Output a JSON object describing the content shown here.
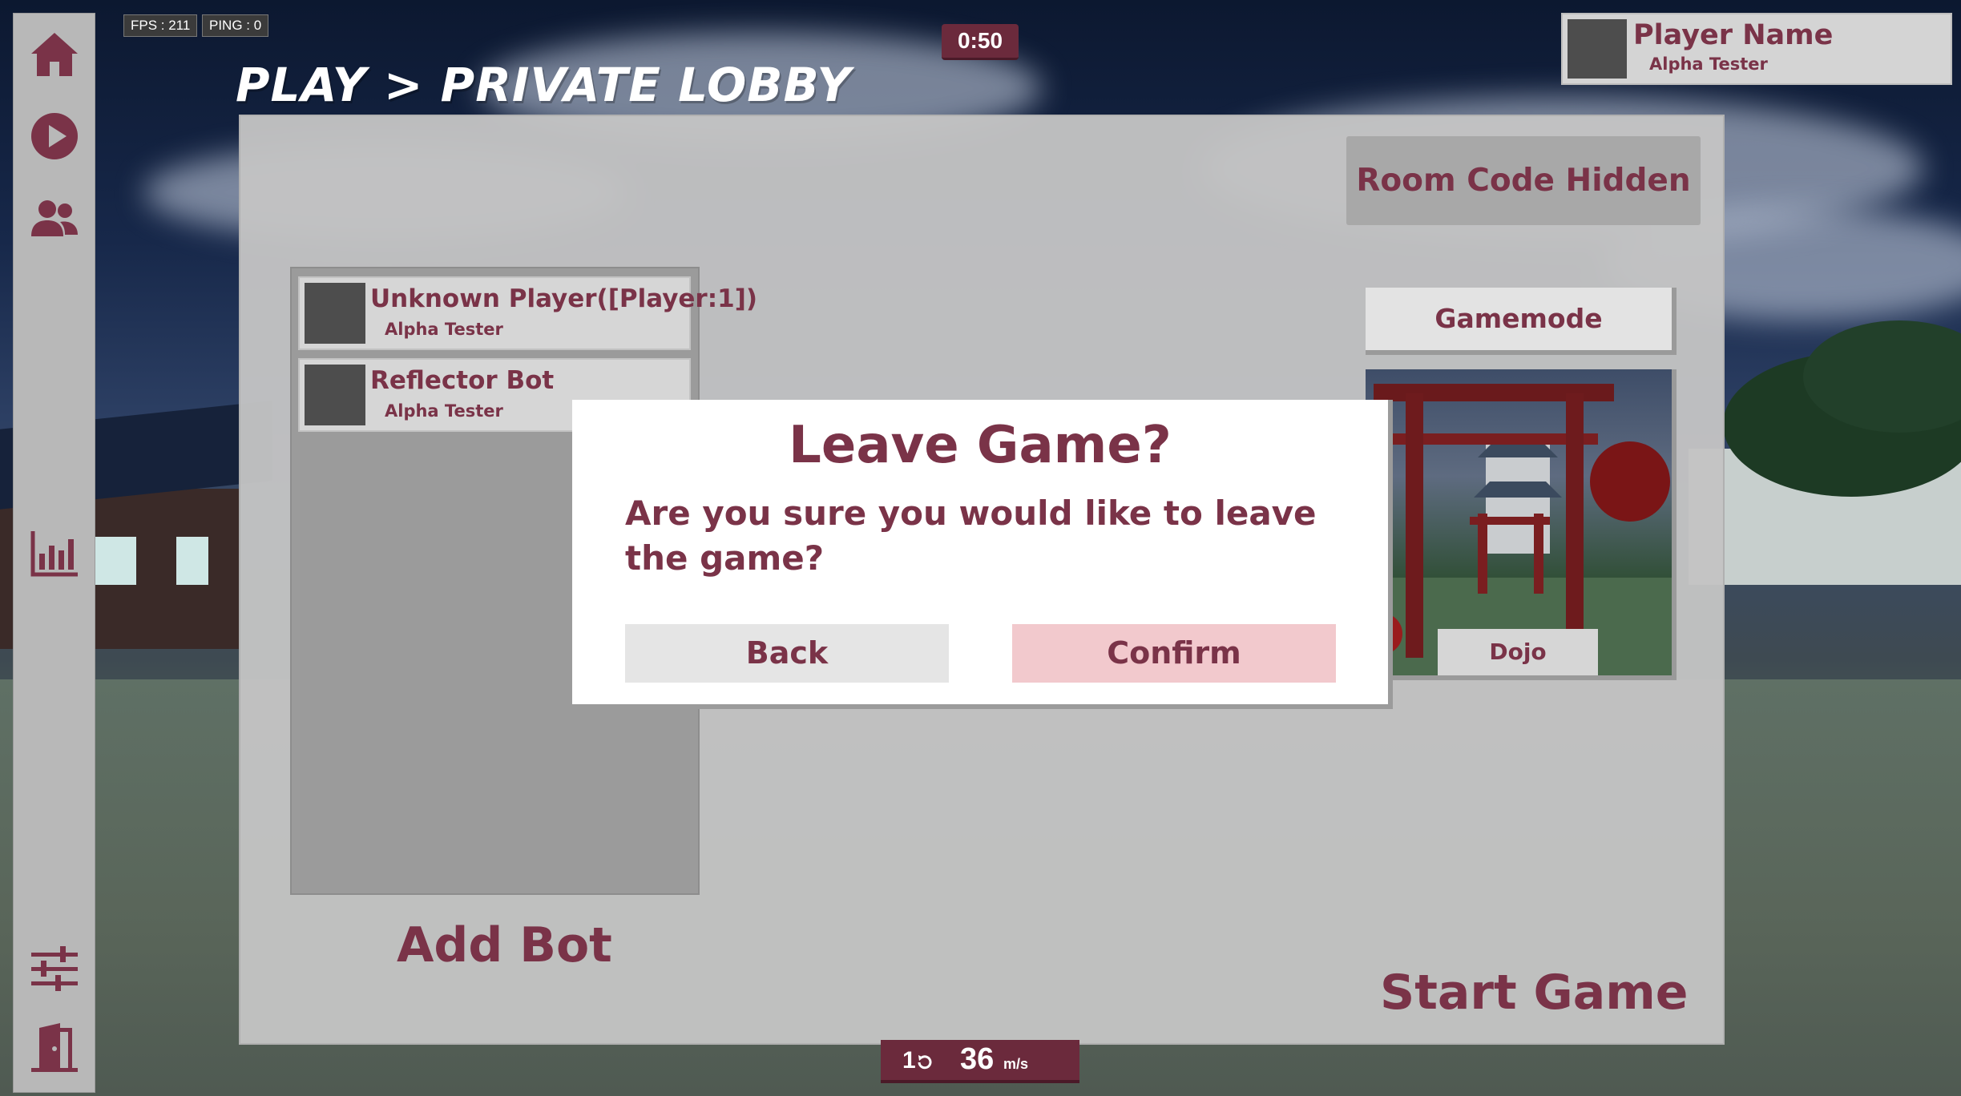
{
  "hud": {
    "fps_label": "FPS : 211",
    "ping_label": "PING : 0",
    "timer": "0:50",
    "speed": {
      "rotations": "1",
      "rotation_icon": "rotate-ccw-icon",
      "value": "36",
      "unit": "m/s"
    }
  },
  "player": {
    "name": "Player Name",
    "title": "Alpha Tester"
  },
  "sidebar": {
    "items": [
      {
        "name": "home",
        "icon": "home-icon"
      },
      {
        "name": "play",
        "icon": "play-icon"
      },
      {
        "name": "friends",
        "icon": "users-icon"
      },
      {
        "name": "stats",
        "icon": "bar-chart-icon"
      },
      {
        "name": "settings",
        "icon": "sliders-icon"
      },
      {
        "name": "exit",
        "icon": "exit-door-icon"
      }
    ]
  },
  "breadcrumb": "PLAY > PRIVATE LOBBY",
  "lobby": {
    "room_code_label": "Room Code Hidden",
    "players": [
      {
        "name": "Unknown Player([Player:1])",
        "title": "Alpha Tester"
      },
      {
        "name": "Reflector Bot",
        "title": "Alpha Tester"
      }
    ],
    "add_bot_label": "Add Bot",
    "gamemode_label": "Gamemode",
    "map_name": "Dojo",
    "start_game_label": "Start Game"
  },
  "modal": {
    "title": "Leave Game?",
    "message": "Are you sure you would like to leave the game?",
    "back_label": "Back",
    "confirm_label": "Confirm"
  },
  "colors": {
    "accent": "#7a3348",
    "hud_bar": "#6b2a3c",
    "confirm_bg": "#f2c9cd",
    "back_bg": "#e5e5e5",
    "panel_bg": "#c4c4c4"
  }
}
